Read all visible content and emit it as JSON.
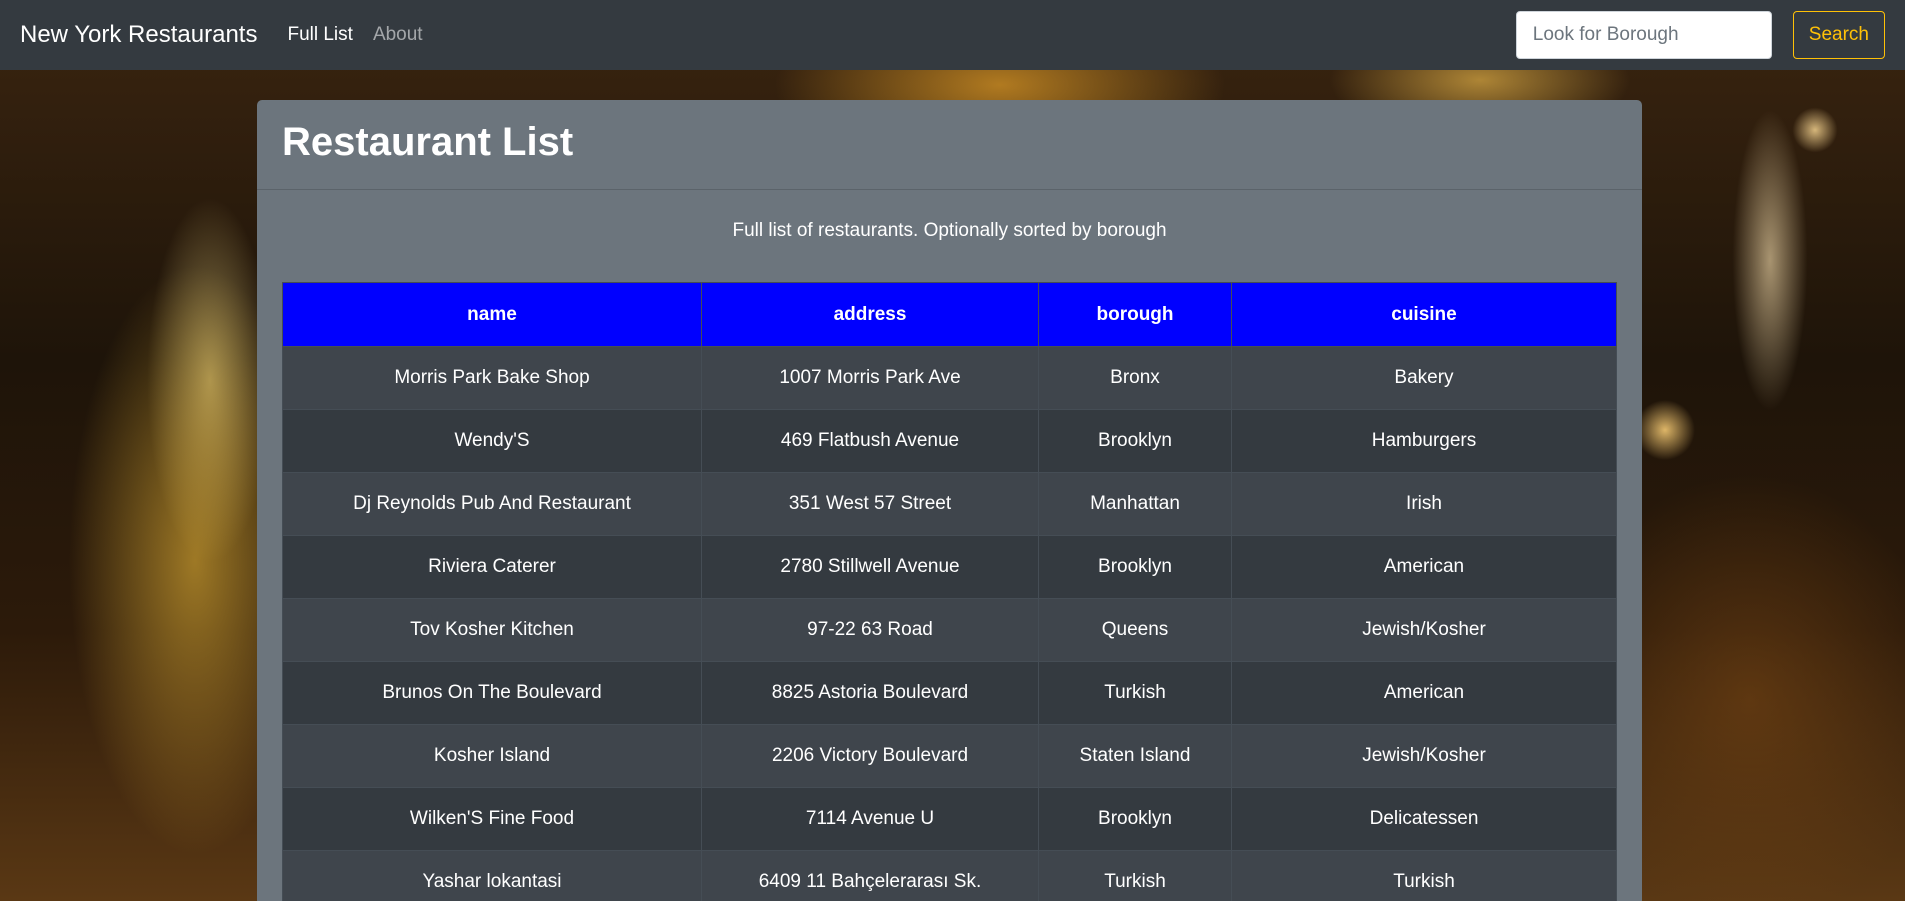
{
  "navbar": {
    "brand": "New York Restaurants",
    "links": [
      {
        "label": "Full List",
        "active": true
      },
      {
        "label": "About",
        "active": false
      }
    ],
    "search": {
      "placeholder": "Look for Borough",
      "value": "",
      "button_label": "Search"
    }
  },
  "card": {
    "title": "Restaurant List",
    "description": "Full list of restaurants. Optionally sorted by borough"
  },
  "table": {
    "headers": [
      "name",
      "address",
      "borough",
      "cuisine"
    ],
    "rows": [
      [
        "Morris Park Bake Shop",
        "1007 Morris Park Ave",
        "Bronx",
        "Bakery"
      ],
      [
        "Wendy'S",
        "469 Flatbush Avenue",
        "Brooklyn",
        "Hamburgers"
      ],
      [
        "Dj Reynolds Pub And Restaurant",
        "351 West 57 Street",
        "Manhattan",
        "Irish"
      ],
      [
        "Riviera Caterer",
        "2780 Stillwell Avenue",
        "Brooklyn",
        "American"
      ],
      [
        "Tov Kosher Kitchen",
        "97-22 63 Road",
        "Queens",
        "Jewish/Kosher"
      ],
      [
        "Brunos On The Boulevard",
        "8825 Astoria Boulevard",
        "Turkish",
        "American"
      ],
      [
        "Kosher Island",
        "2206 Victory Boulevard",
        "Staten Island",
        "Jewish/Kosher"
      ],
      [
        "Wilken'S Fine Food",
        "7114 Avenue U",
        "Brooklyn",
        "Delicatessen"
      ],
      [
        "Yashar lokantasi",
        "6409 11 Bahçelerarası Sk.",
        "Turkish",
        "Turkish"
      ]
    ]
  },
  "colors": {
    "navbar_bg": "#343a40",
    "card_bg": "#6c757d",
    "table_header_bg": "#0000ff",
    "search_accent": "#ffc107"
  }
}
